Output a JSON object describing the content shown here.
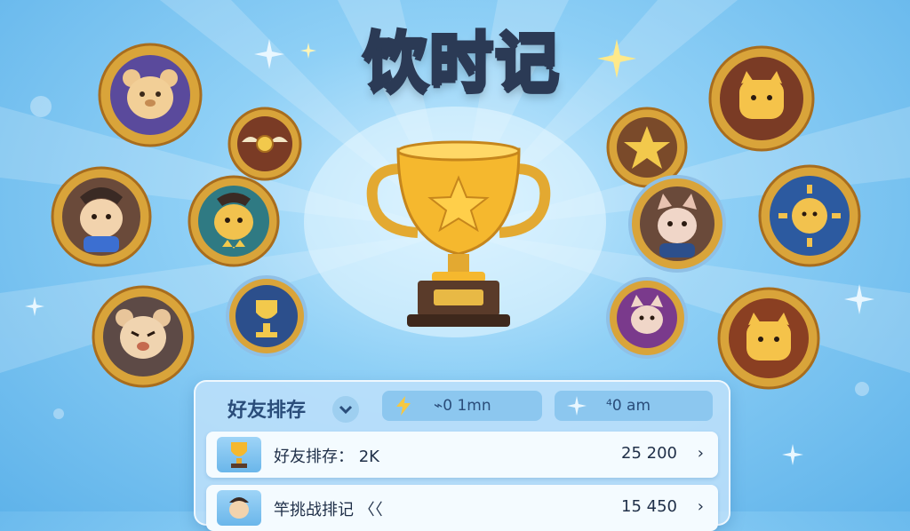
{
  "app": {
    "title": "饮时记"
  },
  "leaderboard": {
    "title": "好友排存",
    "stats": [
      {
        "icon": "lightning-icon",
        "value": "⌁0 1mn"
      },
      {
        "icon": "sparkle-icon",
        "value": "⁴0 am"
      }
    ],
    "rows": [
      {
        "label": "好友排存：  2K",
        "score": "25 200",
        "avatar": "trophy-avatar"
      },
      {
        "label": "竿挑战排记 〈〈",
        "score": "15 450",
        "avatar": "character-avatar"
      }
    ]
  },
  "badges": {
    "left": [
      "bear-badge",
      "bear-boy-badge",
      "bear-angry-badge",
      "winged-ball-badge",
      "lion-badge",
      "trophy-badge"
    ],
    "right": [
      "cat-badge-brown",
      "star-badge",
      "sun-badge",
      "cat-boy-badge",
      "cat-girl-badge",
      "cat-badge-orange"
    ]
  },
  "colors": {
    "accent": "#f5b82e",
    "panel": "#bfe1fa",
    "sky": "#8fd0f6",
    "text": "#1f2f48"
  }
}
